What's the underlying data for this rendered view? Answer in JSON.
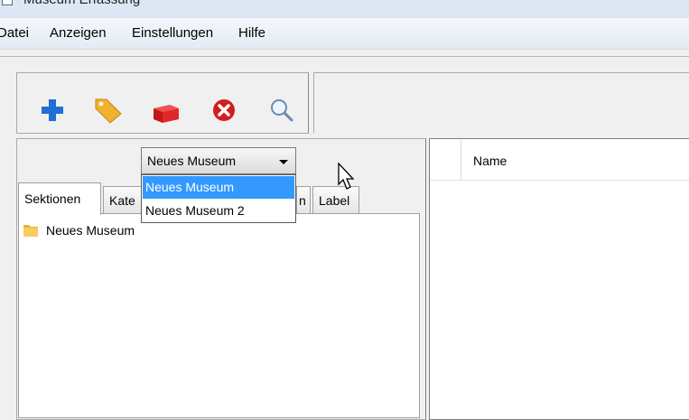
{
  "window": {
    "title": "Museum Erfassung"
  },
  "menubar": {
    "items": [
      "Datei",
      "Anzeigen",
      "Einstellungen",
      "Hilfe"
    ]
  },
  "toolbar": {
    "icons": [
      "add-icon",
      "tag-icon",
      "brick-icon",
      "delete-icon",
      "search-icon"
    ],
    "colors": {
      "add": "#1f6fd6",
      "tag": "#f0b030",
      "brick": "#d42020",
      "delete": "#d01e1e",
      "search": "#6a8ab0"
    }
  },
  "selector": {
    "selected": "Neues Museum",
    "options": [
      "Neues Museum",
      "Neues Museum 2"
    ],
    "highlight_color": "#3399ff"
  },
  "tabs": [
    "Sektionen",
    "Kate",
    "n",
    "Label"
  ],
  "tree": {
    "nodes": [
      "Neues Museum"
    ]
  },
  "table": {
    "columns": [
      "Name"
    ]
  }
}
